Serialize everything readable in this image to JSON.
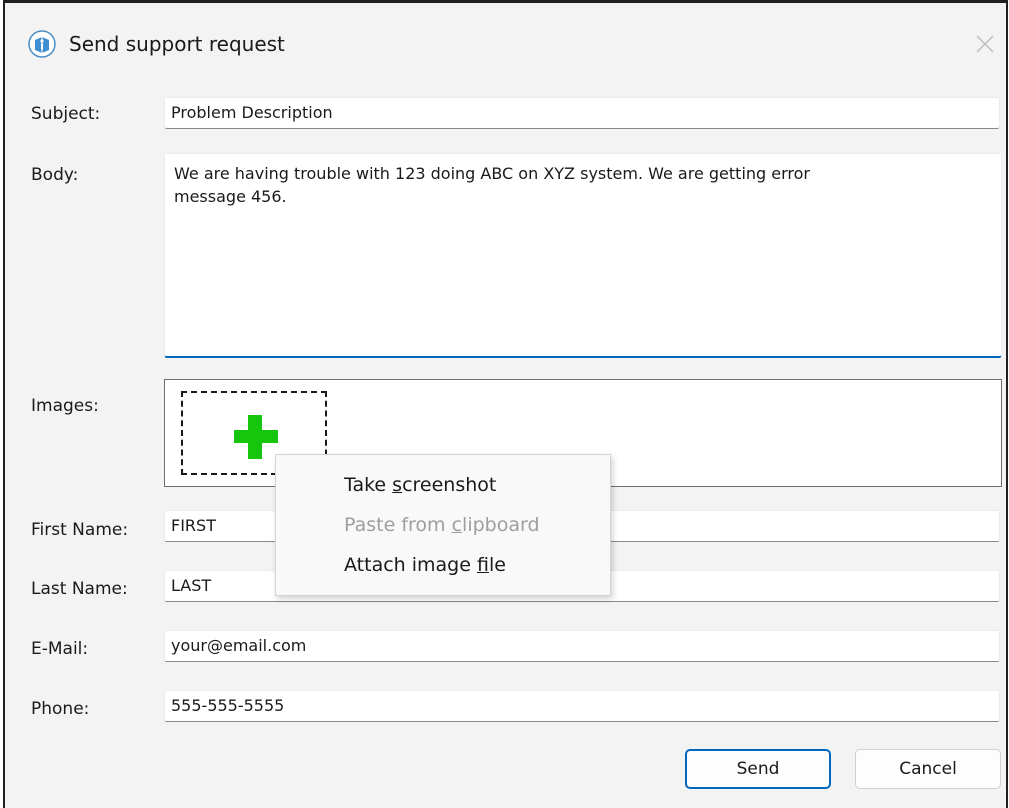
{
  "window": {
    "title": "Send support request"
  },
  "form": {
    "subject_label": "Subject:",
    "subject_value": "Problem Description",
    "body_label": "Body:",
    "body_value": "We are having trouble with 123 doing ABC on XYZ system. We are getting error\nmessage 456.",
    "images_label": "Images:",
    "first_name_label": "First Name:",
    "first_name_value": "FIRST",
    "last_name_label": "Last Name:",
    "last_name_value": "LAST",
    "email_label": "E-Mail:",
    "email_value": "your@email.com",
    "phone_label": "Phone:",
    "phone_value": "555-555-5555"
  },
  "context_menu": {
    "items": [
      {
        "pre": "Take ",
        "accel": "s",
        "post": "creenshot",
        "enabled": true
      },
      {
        "pre": "Paste from ",
        "accel": "c",
        "post": "lipboard",
        "enabled": false
      },
      {
        "pre": "Attach image ",
        "accel": "f",
        "post": "ile",
        "enabled": true
      }
    ]
  },
  "buttons": {
    "send_label": "Send",
    "cancel_label": "Cancel"
  },
  "icons": {
    "app": "support-app-icon",
    "close": "close-icon",
    "add_image": "plus-icon"
  },
  "colors": {
    "accent": "#0067c0",
    "add_icon": "#16c60c",
    "disabled_text": "#9e9e9e"
  }
}
